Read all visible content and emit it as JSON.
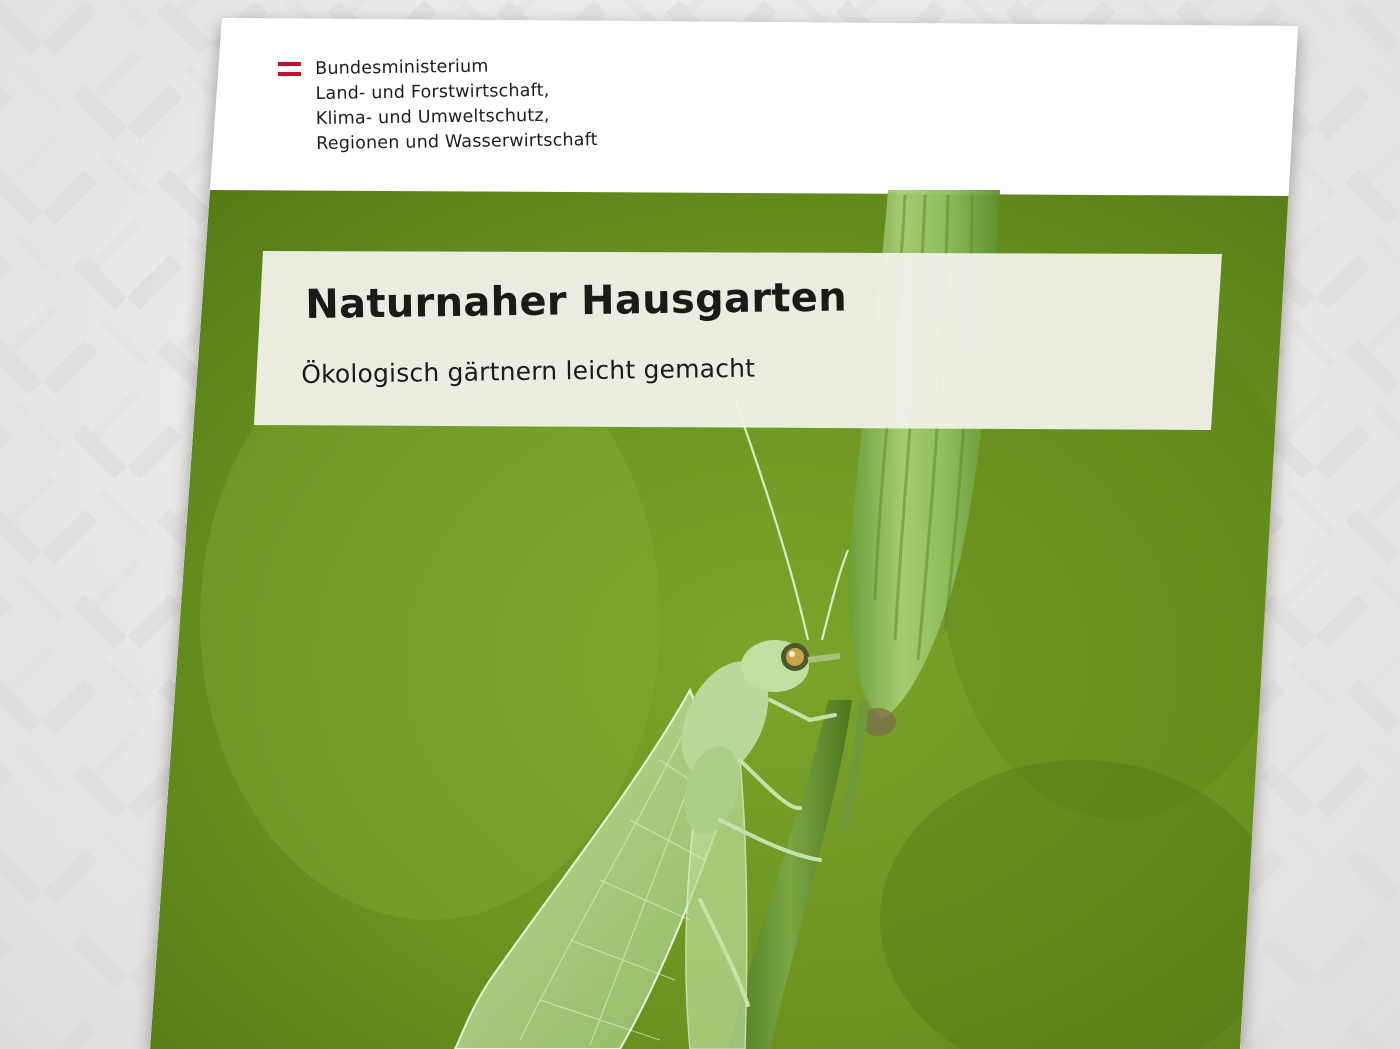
{
  "ministry": {
    "flag_colors": [
      "#c8102e",
      "#ffffff",
      "#c8102e"
    ],
    "lines": [
      "Bundesministerium",
      "Land- und Forstwirtschaft,",
      "Klima- und Umweltschutz,",
      "Regionen und Wasserwirtschaft"
    ]
  },
  "cover": {
    "title": "Naturnaher Hausgarten",
    "subtitle": "Ökologisch gärtnern leicht gemacht",
    "photo": "green-lacewing-on-grass-stem",
    "colors": {
      "background_green": "#6f9a1e",
      "title_box": "#f1f1ea",
      "insect": "#b8dc98",
      "stem": "#5f8a2a"
    }
  }
}
